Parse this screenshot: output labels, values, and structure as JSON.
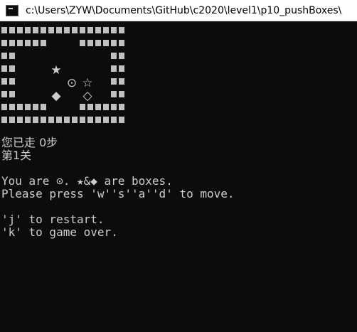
{
  "window": {
    "title": "c:\\Users\\ZYW\\Documents\\GitHub\\c2020\\level1\\p10_pushBoxes\\",
    "icon": "console-icon"
  },
  "colors": {
    "console_bg": "#0c0c0c",
    "console_text": "#cccccc",
    "titlebar_bg": "#ffffff"
  },
  "map": {
    "legend": {
      "wall": "■",
      "player": "⊙",
      "box_a": "★",
      "box_b": "◆",
      "target_a": "☆",
      "target_b": "◇"
    },
    "rows": [
      "########",
      "###  ###",
      "#      #",
      "#  ★   #",
      "#   ⊙☆ #",
      "#  ◆ ◇ #",
      "###  ###",
      "########"
    ]
  },
  "status": {
    "steps": "您已走 0步",
    "level": "第1关"
  },
  "help": {
    "line1": "You are ⊙. ★&◆ are boxes.",
    "line2": "Please press 'w''s''a''d' to move.",
    "line3": "'j' to restart.",
    "line4": "'k' to game over."
  }
}
